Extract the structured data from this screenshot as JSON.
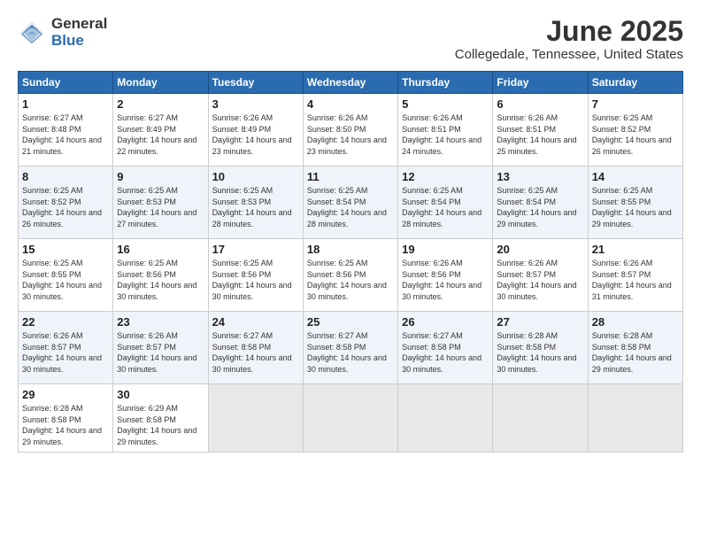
{
  "logo": {
    "general": "General",
    "blue": "Blue"
  },
  "title": "June 2025",
  "subtitle": "Collegedale, Tennessee, United States",
  "headers": [
    "Sunday",
    "Monday",
    "Tuesday",
    "Wednesday",
    "Thursday",
    "Friday",
    "Saturday"
  ],
  "weeks": [
    [
      {
        "day": "1",
        "sunrise": "Sunrise: 6:27 AM",
        "sunset": "Sunset: 8:48 PM",
        "daylight": "Daylight: 14 hours and 21 minutes."
      },
      {
        "day": "2",
        "sunrise": "Sunrise: 6:27 AM",
        "sunset": "Sunset: 8:49 PM",
        "daylight": "Daylight: 14 hours and 22 minutes."
      },
      {
        "day": "3",
        "sunrise": "Sunrise: 6:26 AM",
        "sunset": "Sunset: 8:49 PM",
        "daylight": "Daylight: 14 hours and 23 minutes."
      },
      {
        "day": "4",
        "sunrise": "Sunrise: 6:26 AM",
        "sunset": "Sunset: 8:50 PM",
        "daylight": "Daylight: 14 hours and 23 minutes."
      },
      {
        "day": "5",
        "sunrise": "Sunrise: 6:26 AM",
        "sunset": "Sunset: 8:51 PM",
        "daylight": "Daylight: 14 hours and 24 minutes."
      },
      {
        "day": "6",
        "sunrise": "Sunrise: 6:26 AM",
        "sunset": "Sunset: 8:51 PM",
        "daylight": "Daylight: 14 hours and 25 minutes."
      },
      {
        "day": "7",
        "sunrise": "Sunrise: 6:25 AM",
        "sunset": "Sunset: 8:52 PM",
        "daylight": "Daylight: 14 hours and 26 minutes."
      }
    ],
    [
      {
        "day": "8",
        "sunrise": "Sunrise: 6:25 AM",
        "sunset": "Sunset: 8:52 PM",
        "daylight": "Daylight: 14 hours and 26 minutes."
      },
      {
        "day": "9",
        "sunrise": "Sunrise: 6:25 AM",
        "sunset": "Sunset: 8:53 PM",
        "daylight": "Daylight: 14 hours and 27 minutes."
      },
      {
        "day": "10",
        "sunrise": "Sunrise: 6:25 AM",
        "sunset": "Sunset: 8:53 PM",
        "daylight": "Daylight: 14 hours and 28 minutes."
      },
      {
        "day": "11",
        "sunrise": "Sunrise: 6:25 AM",
        "sunset": "Sunset: 8:54 PM",
        "daylight": "Daylight: 14 hours and 28 minutes."
      },
      {
        "day": "12",
        "sunrise": "Sunrise: 6:25 AM",
        "sunset": "Sunset: 8:54 PM",
        "daylight": "Daylight: 14 hours and 28 minutes."
      },
      {
        "day": "13",
        "sunrise": "Sunrise: 6:25 AM",
        "sunset": "Sunset: 8:54 PM",
        "daylight": "Daylight: 14 hours and 29 minutes."
      },
      {
        "day": "14",
        "sunrise": "Sunrise: 6:25 AM",
        "sunset": "Sunset: 8:55 PM",
        "daylight": "Daylight: 14 hours and 29 minutes."
      }
    ],
    [
      {
        "day": "15",
        "sunrise": "Sunrise: 6:25 AM",
        "sunset": "Sunset: 8:55 PM",
        "daylight": "Daylight: 14 hours and 30 minutes."
      },
      {
        "day": "16",
        "sunrise": "Sunrise: 6:25 AM",
        "sunset": "Sunset: 8:56 PM",
        "daylight": "Daylight: 14 hours and 30 minutes."
      },
      {
        "day": "17",
        "sunrise": "Sunrise: 6:25 AM",
        "sunset": "Sunset: 8:56 PM",
        "daylight": "Daylight: 14 hours and 30 minutes."
      },
      {
        "day": "18",
        "sunrise": "Sunrise: 6:25 AM",
        "sunset": "Sunset: 8:56 PM",
        "daylight": "Daylight: 14 hours and 30 minutes."
      },
      {
        "day": "19",
        "sunrise": "Sunrise: 6:26 AM",
        "sunset": "Sunset: 8:56 PM",
        "daylight": "Daylight: 14 hours and 30 minutes."
      },
      {
        "day": "20",
        "sunrise": "Sunrise: 6:26 AM",
        "sunset": "Sunset: 8:57 PM",
        "daylight": "Daylight: 14 hours and 30 minutes."
      },
      {
        "day": "21",
        "sunrise": "Sunrise: 6:26 AM",
        "sunset": "Sunset: 8:57 PM",
        "daylight": "Daylight: 14 hours and 31 minutes."
      }
    ],
    [
      {
        "day": "22",
        "sunrise": "Sunrise: 6:26 AM",
        "sunset": "Sunset: 8:57 PM",
        "daylight": "Daylight: 14 hours and 30 minutes."
      },
      {
        "day": "23",
        "sunrise": "Sunrise: 6:26 AM",
        "sunset": "Sunset: 8:57 PM",
        "daylight": "Daylight: 14 hours and 30 minutes."
      },
      {
        "day": "24",
        "sunrise": "Sunrise: 6:27 AM",
        "sunset": "Sunset: 8:58 PM",
        "daylight": "Daylight: 14 hours and 30 minutes."
      },
      {
        "day": "25",
        "sunrise": "Sunrise: 6:27 AM",
        "sunset": "Sunset: 8:58 PM",
        "daylight": "Daylight: 14 hours and 30 minutes."
      },
      {
        "day": "26",
        "sunrise": "Sunrise: 6:27 AM",
        "sunset": "Sunset: 8:58 PM",
        "daylight": "Daylight: 14 hours and 30 minutes."
      },
      {
        "day": "27",
        "sunrise": "Sunrise: 6:28 AM",
        "sunset": "Sunset: 8:58 PM",
        "daylight": "Daylight: 14 hours and 30 minutes."
      },
      {
        "day": "28",
        "sunrise": "Sunrise: 6:28 AM",
        "sunset": "Sunset: 8:58 PM",
        "daylight": "Daylight: 14 hours and 29 minutes."
      }
    ],
    [
      {
        "day": "29",
        "sunrise": "Sunrise: 6:28 AM",
        "sunset": "Sunset: 8:58 PM",
        "daylight": "Daylight: 14 hours and 29 minutes."
      },
      {
        "day": "30",
        "sunrise": "Sunrise: 6:29 AM",
        "sunset": "Sunset: 8:58 PM",
        "daylight": "Daylight: 14 hours and 29 minutes."
      },
      null,
      null,
      null,
      null,
      null
    ]
  ]
}
